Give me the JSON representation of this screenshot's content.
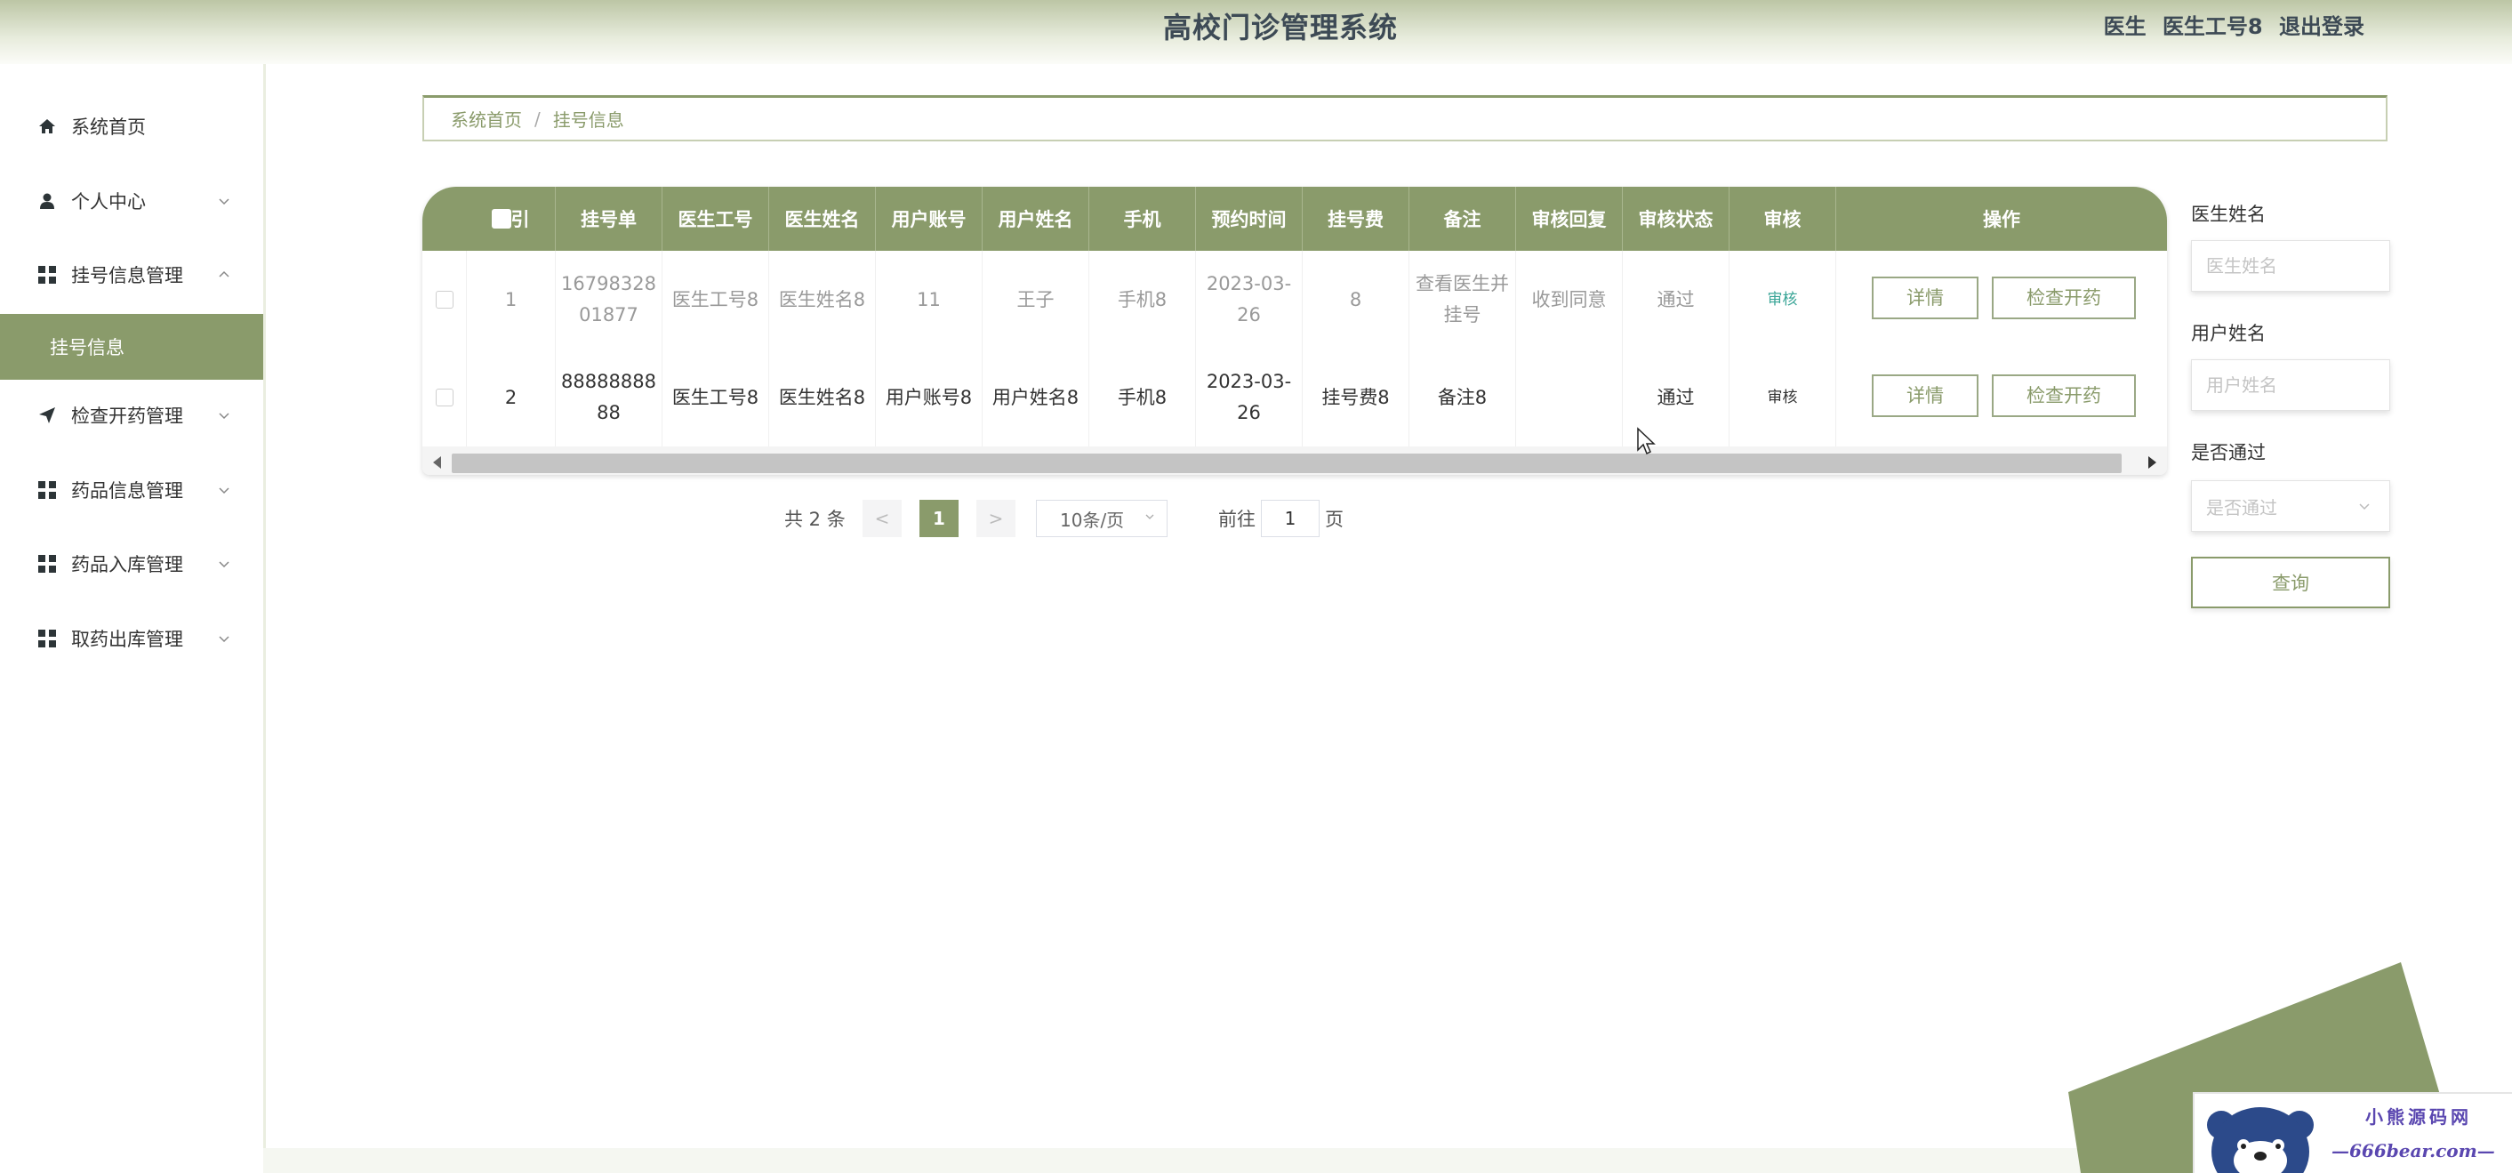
{
  "header": {
    "title": "高校门诊管理系统",
    "role": "医生",
    "user_name": "医生工号8",
    "logout": "退出登录"
  },
  "sidebar": {
    "items": [
      {
        "label": "系统首页",
        "icon": "home-icon"
      },
      {
        "label": "个人中心",
        "icon": "user-icon"
      },
      {
        "label": "挂号信息管理",
        "icon": "grid-icon"
      },
      {
        "label": "挂号信息",
        "icon": ""
      },
      {
        "label": "检查开药管理",
        "icon": "send-icon"
      },
      {
        "label": "药品信息管理",
        "icon": "grid-icon"
      },
      {
        "label": "药品入库管理",
        "icon": "grid-icon"
      },
      {
        "label": "取药出库管理",
        "icon": "grid-icon"
      }
    ]
  },
  "breadcrumb": {
    "home": "系统首页",
    "separator": "/",
    "current": "挂号信息"
  },
  "table": {
    "columns": [
      "索引",
      "挂号单",
      "医生工号",
      "医生姓名",
      "用户账号",
      "用户姓名",
      "手机",
      "预约时间",
      "挂号费",
      "备注",
      "审核回复",
      "审核状态",
      "审核",
      "操作"
    ],
    "rows": [
      {
        "index": "1",
        "reg_no": "1679832801877",
        "doctor_id": "医生工号8",
        "doctor_name": "医生姓名8",
        "user_account": "11",
        "user_name": "王子",
        "phone": "手机8",
        "time": "2023-03-26",
        "fee": "8",
        "remark": "查看医生并挂号",
        "reply": "收到同意",
        "status": "通过",
        "audit": "审核",
        "detail": "详情",
        "prescribe": "检查开药"
      },
      {
        "index": "2",
        "reg_no": "8888888888",
        "doctor_id": "医生工号8",
        "doctor_name": "医生姓名8",
        "user_account": "用户账号8",
        "user_name": "用户姓名8",
        "phone": "手机8",
        "time": "2023-03-26",
        "fee": "挂号费8",
        "remark": "备注8",
        "reply": "",
        "status": "通过",
        "audit": "审核",
        "detail": "详情",
        "prescribe": "检查开药"
      }
    ]
  },
  "pagination": {
    "total": "共 2 条",
    "prev": "<",
    "current": "1",
    "next": ">",
    "page_size": "10条/页",
    "goto_label": "前往",
    "goto_value": "1",
    "page_unit": "页"
  },
  "search": {
    "doctor_name_label": "医生姓名",
    "doctor_name_placeholder": "医生姓名",
    "user_name_label": "用户姓名",
    "user_name_placeholder": "用户姓名",
    "passed_label": "是否通过",
    "passed_placeholder": "是否通过",
    "query_button": "查询"
  },
  "watermark": {
    "cn": "小熊源码网",
    "en": "—666bear.com—"
  },
  "colors": {
    "accent": "#8a9b6b",
    "audit_link": "#3aa597"
  }
}
